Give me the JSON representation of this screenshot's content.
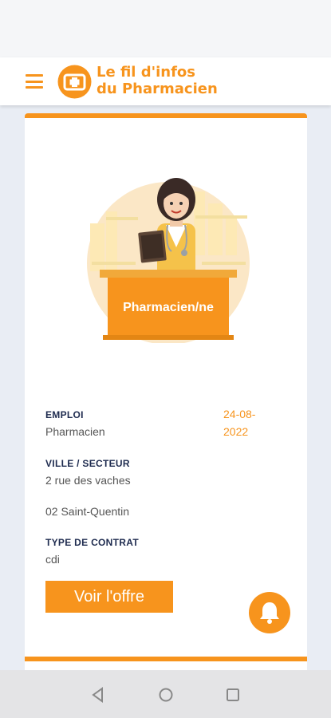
{
  "header": {
    "title_line1": "Le fil d'infos",
    "title_line2": "du Pharmacien",
    "menu_icon": "hamburger-menu-icon",
    "logo_icon": "pharmacy-cross-logo-icon"
  },
  "job": {
    "illustration_label": "Pharmacien/ne",
    "emploi_label": "EMPLOI",
    "emploi_value": "Pharmacien",
    "date_line1": "24-08-",
    "date_line2": "2022",
    "ville_label": "VILLE / SECTEUR",
    "address": "2 rue des vaches",
    "city": "02 Saint-Quentin",
    "contrat_label": "TYPE DE CONTRAT",
    "contrat_value": "cdi",
    "cta_label": "Voir l'offre"
  },
  "colors": {
    "accent": "#f7941d",
    "label": "#1e2b4f"
  },
  "nav": {
    "back_icon": "back-triangle-icon",
    "home_icon": "home-circle-icon",
    "recents_icon": "recents-square-icon"
  }
}
